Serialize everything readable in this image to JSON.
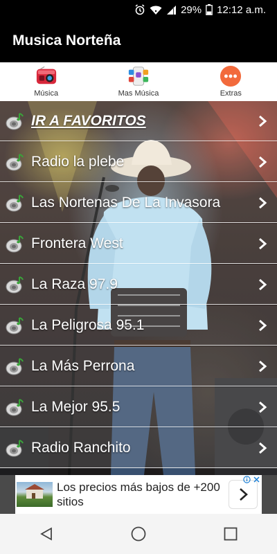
{
  "status": {
    "battery": "29%",
    "time": "12:12 a.m."
  },
  "toolbar": {
    "title": "Musica Norteña"
  },
  "tabs": [
    {
      "label": "Música",
      "icon": "radio-icon"
    },
    {
      "label": "Mas Música",
      "icon": "apps-icon"
    },
    {
      "label": "Extras",
      "icon": "more-icon"
    }
  ],
  "list": [
    {
      "label": "IR A FAVORITOS",
      "favorite": true
    },
    {
      "label": "Radio la plebe"
    },
    {
      "label": "Las Nortenas De La Invasora"
    },
    {
      "label": "Frontera West"
    },
    {
      "label": "La Raza 97.9"
    },
    {
      "label": "La Peligrosa 95.1"
    },
    {
      "label": "La Más Perrona"
    },
    {
      "label": "La Mejor 95.5"
    },
    {
      "label": "Radio Ranchito"
    }
  ],
  "ad": {
    "text": "Los precios más bajos de +200 sitios"
  },
  "colors": {
    "toolbar": "#000000",
    "extras_accent": "#f26a3c",
    "radio_red": "#d8283b"
  }
}
